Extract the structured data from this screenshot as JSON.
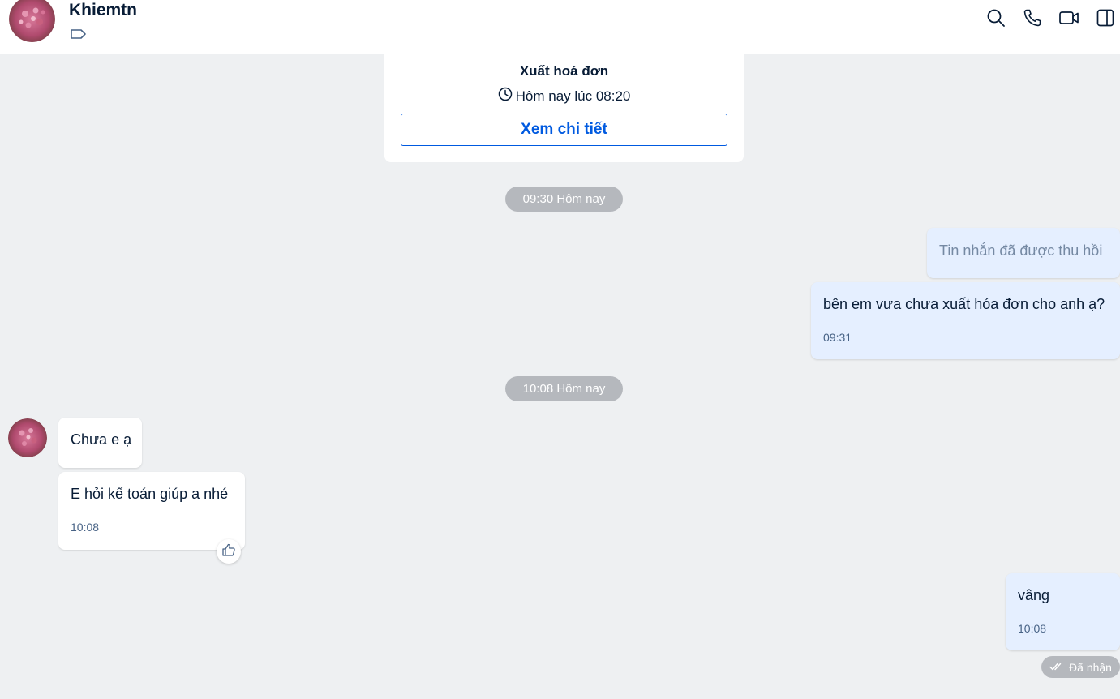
{
  "header": {
    "contact_name": "Khiemtn",
    "icons": [
      "tag-icon",
      "search-icon",
      "phone-icon",
      "video-icon",
      "sidebar-toggle-icon"
    ]
  },
  "invoice_card": {
    "title": "Xuất hoá đơn",
    "time": "Hôm nay lúc 08:20",
    "button_label": "Xem chi tiết"
  },
  "dividers": {
    "first": "09:30 Hôm nay",
    "second": "10:08 Hôm nay"
  },
  "messages": [
    {
      "side": "me",
      "text": "Tin nhắn đã được thu hồi",
      "recalled": true
    },
    {
      "side": "me",
      "text": "bên em vưa chưa xuất hóa đơn cho anh ạ?",
      "time": "09:31"
    },
    {
      "side": "them",
      "text": "Chưa e ạ"
    },
    {
      "side": "them",
      "text": "E hỏi kế toán giúp a nhé",
      "time": "10:08"
    },
    {
      "side": "me",
      "text": "vâng",
      "time": "10:08"
    }
  ],
  "status": {
    "label": "Đã nhận"
  },
  "colors": {
    "accent": "#005ae0",
    "my_bubble": "#e5efff",
    "their_bubble": "#ffffff",
    "chat_background": "#eef0f2",
    "pill": "#b5b8bd"
  }
}
